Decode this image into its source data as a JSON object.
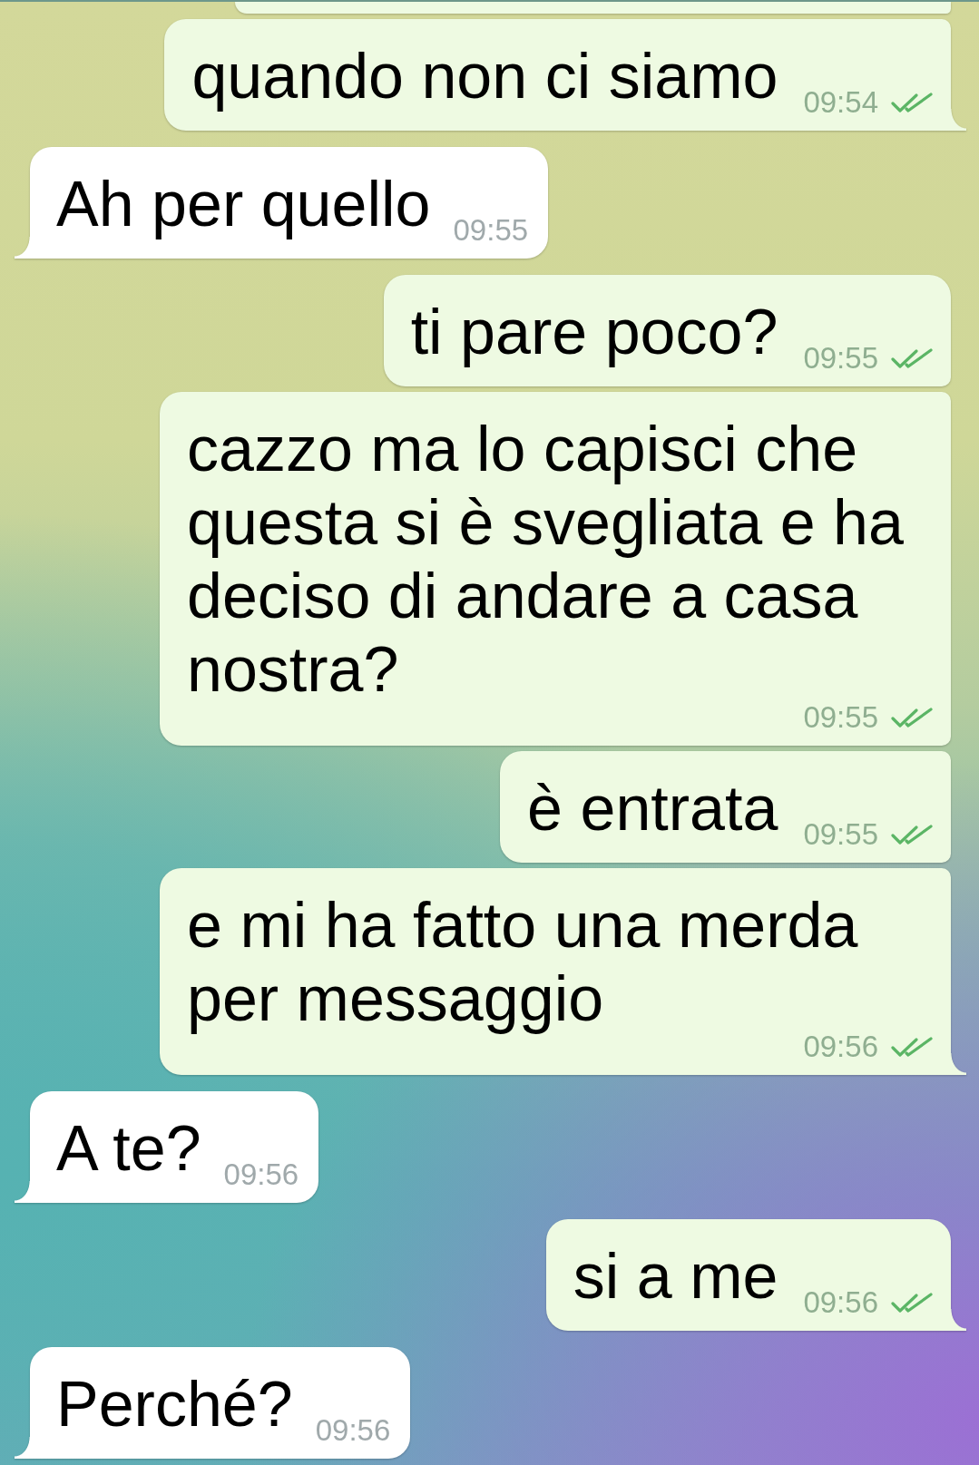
{
  "clipped_message_above": {
    "kind": "outgoing"
  },
  "messages": [
    {
      "kind": "outgoing",
      "text": "quando non ci siamo",
      "time": "09:54",
      "read": true
    },
    {
      "kind": "incoming",
      "text": "Ah per quello",
      "time": "09:55"
    },
    {
      "kind": "outgoing",
      "text": "ti pare poco?",
      "time": "09:55",
      "read": true
    },
    {
      "kind": "outgoing",
      "text": "cazzo ma lo capisci che questa si è svegliata e ha deciso di andare a casa nostra?",
      "time": "09:55",
      "read": true
    },
    {
      "kind": "outgoing",
      "text": "è entrata",
      "time": "09:55",
      "read": true
    },
    {
      "kind": "outgoing",
      "text": "e mi ha fatto una merda per messaggio",
      "time": "09:56",
      "read": true
    },
    {
      "kind": "incoming",
      "text": "A te?",
      "time": "09:56"
    },
    {
      "kind": "outgoing",
      "text": "si a me",
      "time": "09:56",
      "read": true
    },
    {
      "kind": "incoming",
      "text": "Perché?",
      "time": "09:56"
    }
  ]
}
